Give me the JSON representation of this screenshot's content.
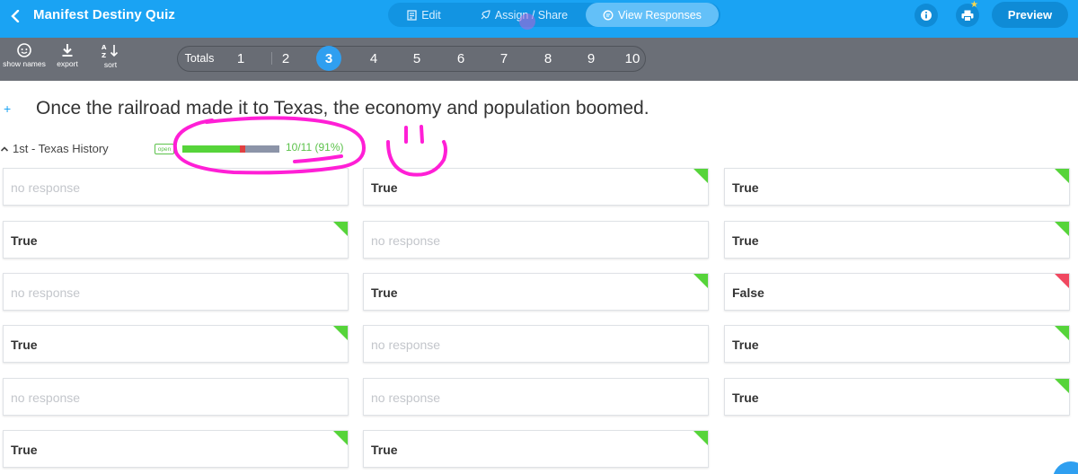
{
  "header": {
    "title": "Manifest Destiny Quiz",
    "tabs": [
      {
        "label": "Edit",
        "icon": "edit-icon"
      },
      {
        "label": "Assign / Share",
        "icon": "rocket-icon"
      },
      {
        "label": "View Responses",
        "icon": "chat-icon"
      }
    ],
    "active_tab": "View Responses",
    "preview_label": "Preview",
    "accent_color": "#1aa3f3"
  },
  "toolbar": {
    "show_names_label": "show names",
    "export_label": "export",
    "sort_label": "sort",
    "totals_label": "Totals",
    "questions": [
      "1",
      "2",
      "3",
      "4",
      "5",
      "6",
      "7",
      "8",
      "9",
      "10"
    ],
    "active_question": "3"
  },
  "question": {
    "text": "Once the railroad made it to Texas, the economy and population boomed."
  },
  "class_section": {
    "name": "1st - Texas History",
    "badge": "open",
    "score_text": "10/11 (91%)",
    "correct_fraction": 0.91
  },
  "responses": {
    "no_response_text": "no response",
    "cards": [
      {
        "text": "",
        "status": "none"
      },
      {
        "text": "True",
        "status": "correct"
      },
      {
        "text": "True",
        "status": "correct"
      },
      {
        "text": "True",
        "status": "correct"
      },
      {
        "text": "",
        "status": "none"
      },
      {
        "text": "True",
        "status": "correct"
      },
      {
        "text": "",
        "status": "none"
      },
      {
        "text": "True",
        "status": "correct"
      },
      {
        "text": "False",
        "status": "wrong"
      },
      {
        "text": "True",
        "status": "correct"
      },
      {
        "text": "",
        "status": "none"
      },
      {
        "text": "True",
        "status": "correct"
      },
      {
        "text": "",
        "status": "none"
      },
      {
        "text": "",
        "status": "none"
      },
      {
        "text": "True",
        "status": "correct"
      },
      {
        "text": "True",
        "status": "correct"
      },
      {
        "text": "True",
        "status": "correct"
      }
    ]
  }
}
